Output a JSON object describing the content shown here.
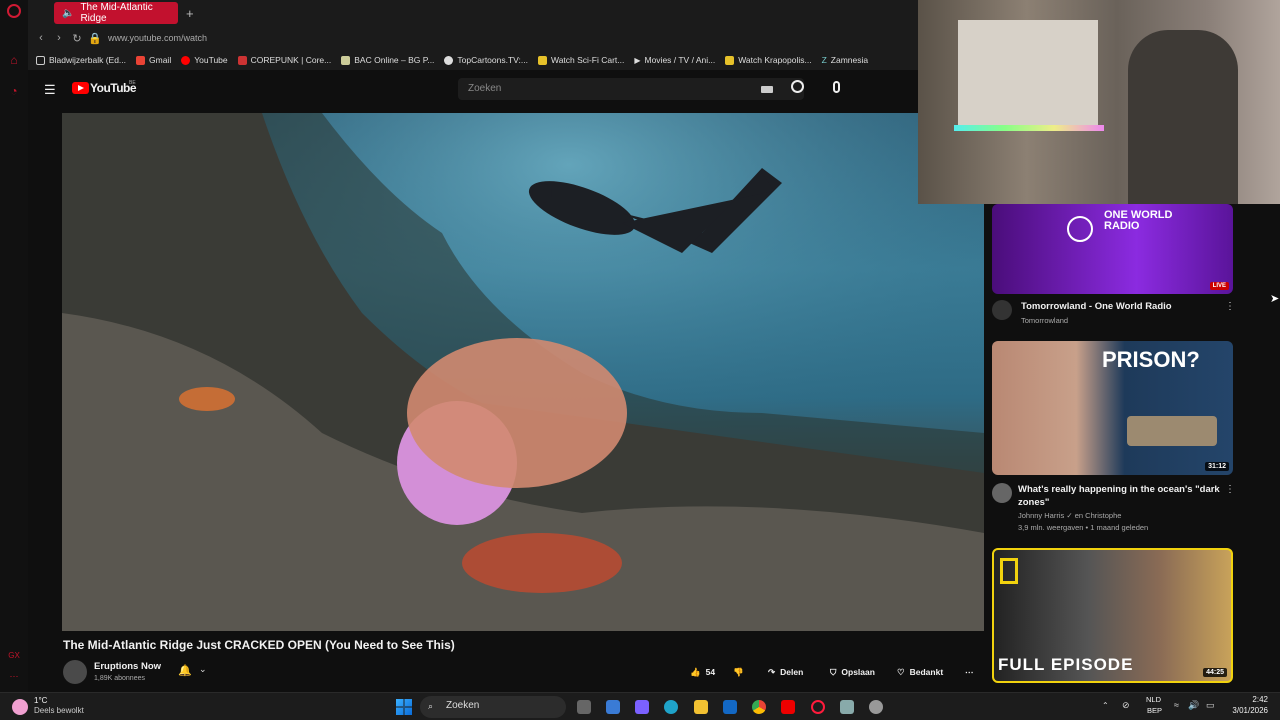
{
  "browser": {
    "tab_title": "The Mid-Atlantic Ridge",
    "url": "www.youtube.com/watch",
    "bookmarks": [
      "Bladwijzerbalk (Ed...",
      "Gmail",
      "YouTube",
      "COREPUNK | Core...",
      "BAC Online – BG P...",
      "TopCartoons.TV:...",
      "Watch Sci-Fi Cart...",
      "Movies / TV / Ani...",
      "Watch Krapopolis...",
      "Zamnesia"
    ]
  },
  "youtube": {
    "logo_text": "YouTube",
    "region": "BE",
    "search_placeholder": "Zoeken"
  },
  "video": {
    "title": "The Mid-Atlantic Ridge Just CRACKED OPEN (You Need to See This)",
    "channel": "Eruptions Now",
    "subscribers": "1,89K abonnees",
    "likes": "54",
    "share": "Delen",
    "save": "Opslaan",
    "thanks": "Bedankt"
  },
  "recommendations": [
    {
      "title": "Tomorrowland - One World Radio",
      "channel": "Tomorrowland",
      "live": "LIVE",
      "thumb_text": "ONE WORLD RADIO"
    },
    {
      "title_line1": "What's really happening in the ocean's \"dark",
      "title_line2": "zones\"",
      "channel": "Johnny Harris",
      "channel_extra": "en Christophe",
      "meta": "3,9 mln. weergaven • 1 maand geleden",
      "duration": "31:12",
      "thumb_text": "PRISON?"
    },
    {
      "thumb_text": "FULL EPISODE",
      "duration": "44:25"
    }
  ],
  "taskbar": {
    "weather_temp": "1°C",
    "weather_desc": "Deels bewolkt",
    "search": "Zoeken",
    "lang1": "NLD",
    "lang2": "BEP",
    "time": "2:42",
    "date": "3/01/2026"
  }
}
